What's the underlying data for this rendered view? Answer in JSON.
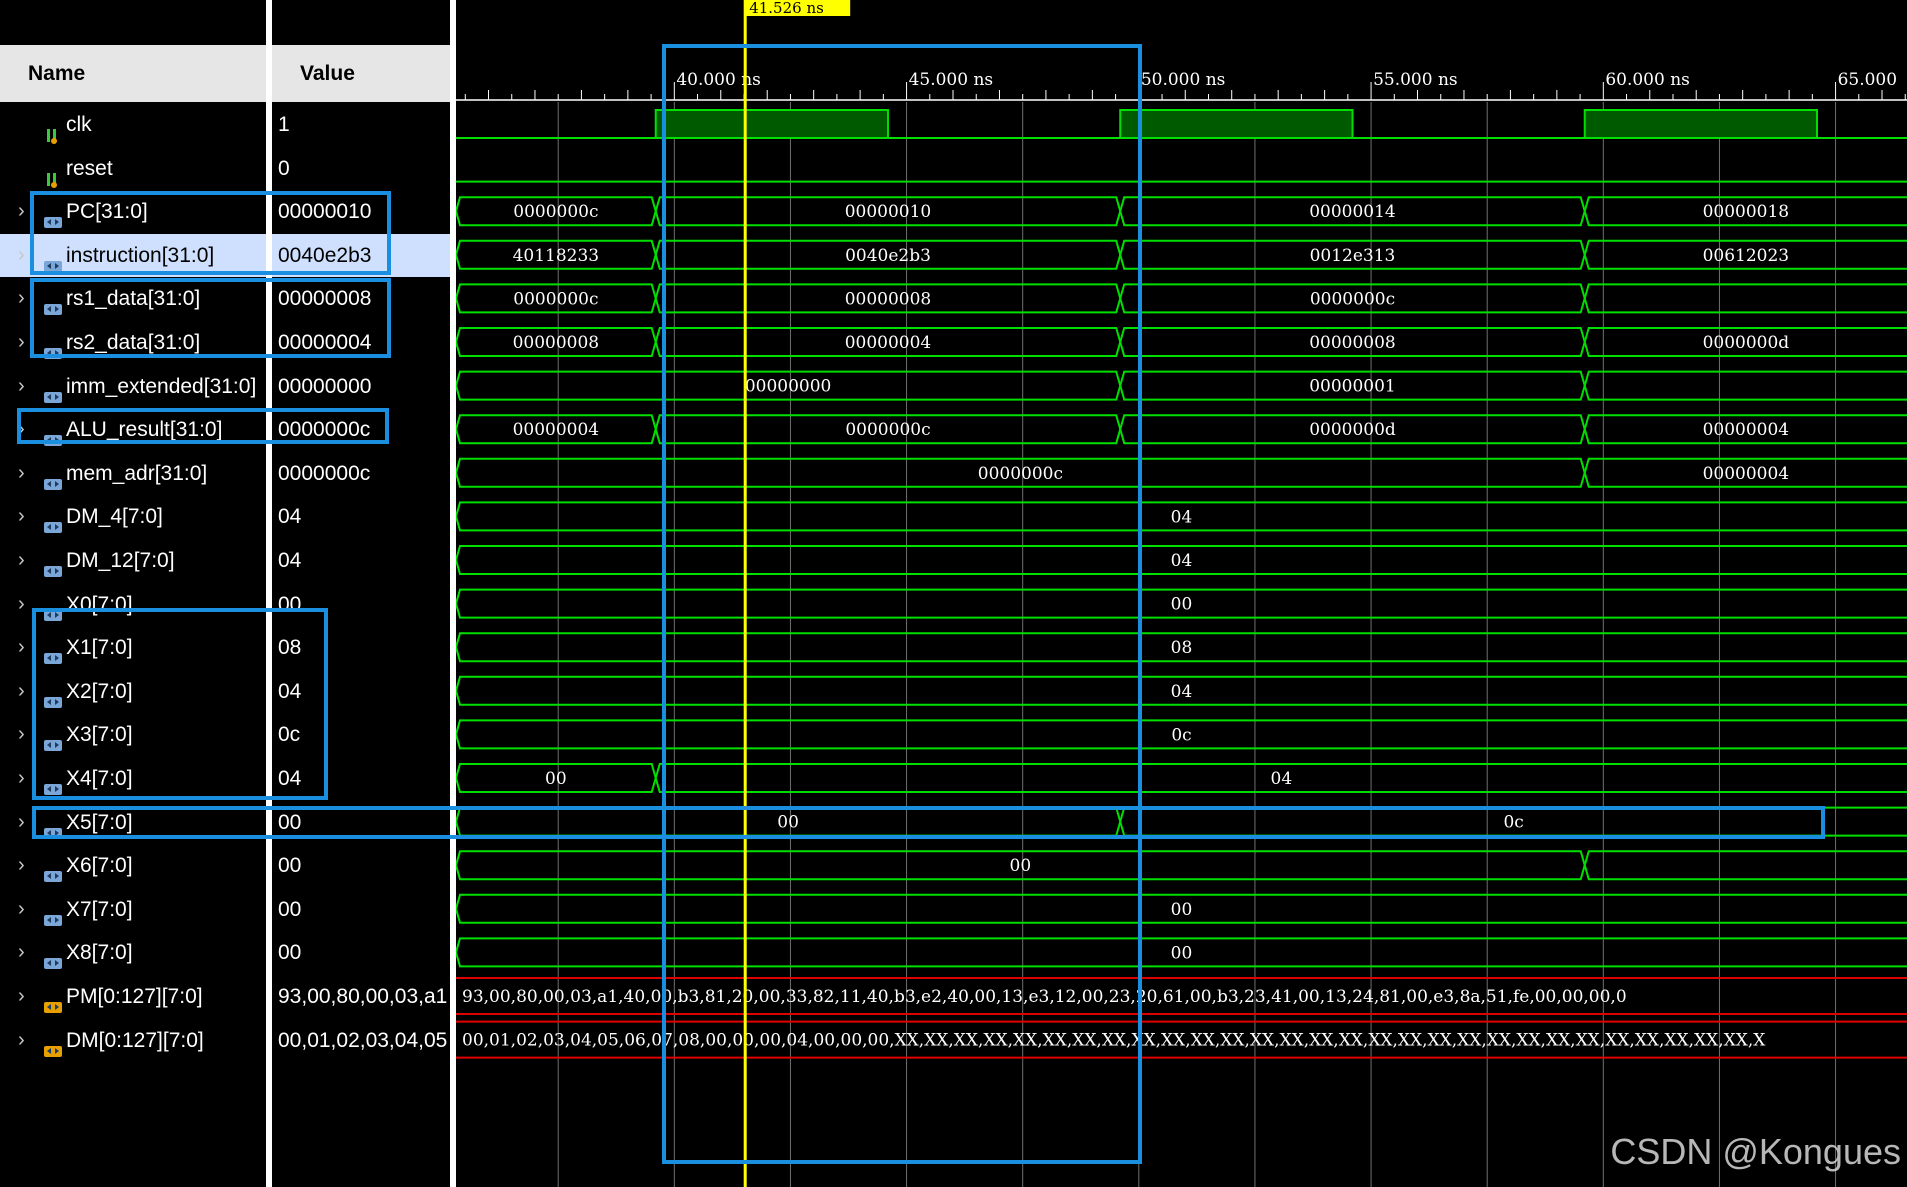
{
  "headers": {
    "name": "Name",
    "value": "Value"
  },
  "cursor": {
    "label": "41.526 ns",
    "time_ns": 41.526
  },
  "time_axis": {
    "unit": "ns",
    "ticks": [
      "40.000 ns",
      "45.000 ns",
      "50.000 ns",
      "55.000 ns",
      "60.000 ns",
      "65.000"
    ]
  },
  "signals": [
    {
      "name": "clk",
      "value": "1",
      "kind": "bit",
      "expandable": false
    },
    {
      "name": "reset",
      "value": "0",
      "kind": "bit",
      "expandable": false
    },
    {
      "name": "PC[31:0]",
      "value": "00000010",
      "kind": "bus",
      "expandable": true,
      "segments": [
        {
          "t0": 35.3,
          "t1": 39.6,
          "v": "0000000c"
        },
        {
          "t0": 39.6,
          "t1": 49.6,
          "v": "00000010"
        },
        {
          "t0": 49.6,
          "t1": 59.6,
          "v": "00000014"
        },
        {
          "t0": 59.6,
          "t1": 66.8,
          "v": "00000018"
        }
      ]
    },
    {
      "name": "instruction[31:0]",
      "value": "0040e2b3",
      "kind": "bus",
      "expandable": true,
      "selected": true,
      "segments": [
        {
          "t0": 35.3,
          "t1": 39.6,
          "v": "40118233"
        },
        {
          "t0": 39.6,
          "t1": 49.6,
          "v": "0040e2b3"
        },
        {
          "t0": 49.6,
          "t1": 59.6,
          "v": "0012e313"
        },
        {
          "t0": 59.6,
          "t1": 66.8,
          "v": "00612023"
        }
      ]
    },
    {
      "name": "rs1_data[31:0]",
      "value": "00000008",
      "kind": "bus",
      "expandable": true,
      "segments": [
        {
          "t0": 35.3,
          "t1": 39.6,
          "v": "0000000c"
        },
        {
          "t0": 39.6,
          "t1": 49.6,
          "v": "00000008"
        },
        {
          "t0": 49.6,
          "t1": 59.6,
          "v": "0000000c"
        },
        {
          "t0": 59.6,
          "t1": 66.8,
          "v": ""
        }
      ]
    },
    {
      "name": "rs2_data[31:0]",
      "value": "00000004",
      "kind": "bus",
      "expandable": true,
      "segments": [
        {
          "t0": 35.3,
          "t1": 39.6,
          "v": "00000008"
        },
        {
          "t0": 39.6,
          "t1": 49.6,
          "v": "00000004"
        },
        {
          "t0": 49.6,
          "t1": 59.6,
          "v": "00000008"
        },
        {
          "t0": 59.6,
          "t1": 66.8,
          "v": "0000000d"
        }
      ]
    },
    {
      "name": "imm_extended[31:0]",
      "value": "00000000",
      "kind": "bus",
      "expandable": true,
      "segments": [
        {
          "t0": 35.3,
          "t1": 49.6,
          "v": "00000000"
        },
        {
          "t0": 49.6,
          "t1": 59.6,
          "v": "00000001"
        },
        {
          "t0": 59.6,
          "t1": 66.8,
          "v": ""
        }
      ]
    },
    {
      "name": "ALU_result[31:0]",
      "value": "0000000c",
      "kind": "bus",
      "expandable": true,
      "segments": [
        {
          "t0": 35.3,
          "t1": 39.6,
          "v": "00000004"
        },
        {
          "t0": 39.6,
          "t1": 49.6,
          "v": "0000000c"
        },
        {
          "t0": 49.6,
          "t1": 59.6,
          "v": "0000000d"
        },
        {
          "t0": 59.6,
          "t1": 66.8,
          "v": "00000004"
        }
      ]
    },
    {
      "name": "mem_adr[31:0]",
      "value": "0000000c",
      "kind": "bus",
      "expandable": true,
      "segments": [
        {
          "t0": 35.3,
          "t1": 59.6,
          "v": "0000000c"
        },
        {
          "t0": 59.6,
          "t1": 66.8,
          "v": "00000004"
        }
      ]
    },
    {
      "name": "DM_4[7:0]",
      "value": "04",
      "kind": "bus",
      "expandable": true,
      "segments": [
        {
          "t0": 35.3,
          "t1": 66.8,
          "v": "04"
        }
      ]
    },
    {
      "name": "DM_12[7:0]",
      "value": "04",
      "kind": "bus",
      "expandable": true,
      "segments": [
        {
          "t0": 35.3,
          "t1": 66.8,
          "v": "04"
        }
      ]
    },
    {
      "name": "X0[7:0]",
      "value": "00",
      "kind": "bus",
      "expandable": true,
      "segments": [
        {
          "t0": 35.3,
          "t1": 66.8,
          "v": "00"
        }
      ]
    },
    {
      "name": "X1[7:0]",
      "value": "08",
      "kind": "bus",
      "expandable": true,
      "segments": [
        {
          "t0": 35.3,
          "t1": 66.8,
          "v": "08"
        }
      ]
    },
    {
      "name": "X2[7:0]",
      "value": "04",
      "kind": "bus",
      "expandable": true,
      "segments": [
        {
          "t0": 35.3,
          "t1": 66.8,
          "v": "04"
        }
      ]
    },
    {
      "name": "X3[7:0]",
      "value": "0c",
      "kind": "bus",
      "expandable": true,
      "segments": [
        {
          "t0": 35.3,
          "t1": 66.8,
          "v": "0c"
        }
      ]
    },
    {
      "name": "X4[7:0]",
      "value": "04",
      "kind": "bus",
      "expandable": true,
      "segments": [
        {
          "t0": 35.3,
          "t1": 39.6,
          "v": "00"
        },
        {
          "t0": 39.6,
          "t1": 66.8,
          "v": "04"
        }
      ]
    },
    {
      "name": "X5[7:0]",
      "value": "00",
      "kind": "bus",
      "expandable": true,
      "segments": [
        {
          "t0": 35.3,
          "t1": 49.6,
          "v": "00"
        },
        {
          "t0": 49.6,
          "t1": 66.8,
          "v": "0c"
        }
      ]
    },
    {
      "name": "X6[7:0]",
      "value": "00",
      "kind": "bus",
      "expandable": true,
      "segments": [
        {
          "t0": 35.3,
          "t1": 59.6,
          "v": "00"
        },
        {
          "t0": 59.6,
          "t1": 66.8,
          "v": ""
        }
      ]
    },
    {
      "name": "X7[7:0]",
      "value": "00",
      "kind": "bus",
      "expandable": true,
      "segments": [
        {
          "t0": 35.3,
          "t1": 66.8,
          "v": "00"
        }
      ]
    },
    {
      "name": "X8[7:0]",
      "value": "00",
      "kind": "bus",
      "expandable": true,
      "segments": [
        {
          "t0": 35.3,
          "t1": 66.8,
          "v": "00"
        }
      ]
    },
    {
      "name": "PM[0:127][7:0]",
      "value": "93,00,80,00,03,a1",
      "kind": "array",
      "expandable": true,
      "wave_text": "93,00,80,00,03,a1,40,00,b3,81,20,00,33,82,11,40,b3,e2,40,00,13,e3,12,00,23,20,61,00,b3,23,41,00,13,24,81,00,e3,8a,51,fe,00,00,00,0"
    },
    {
      "name": "DM[0:127][7:0]",
      "value": "00,01,02,03,04,05",
      "kind": "array",
      "expandable": true,
      "wave_text": "00,01,02,03,04,05,06,07,08,00,00,00,04,00,00,00,XX,XX,XX,XX,XX,XX,XX,XX,XX,XX,XX,XX,XX,XX,XX,XX,XX,XX,XX,XX,XX,XX,XX,XX,XX,XX,XX,XX,XX,X"
    }
  ],
  "watermark": "CSDN @Kongues",
  "colors": {
    "background": "#000000",
    "wave": "#00e000",
    "clk_fill": "#005a00",
    "cursor": "#ffff00",
    "array_border": "#e00000",
    "highlight": "#1a8fe0",
    "selected_row": "#cfe0ff"
  }
}
